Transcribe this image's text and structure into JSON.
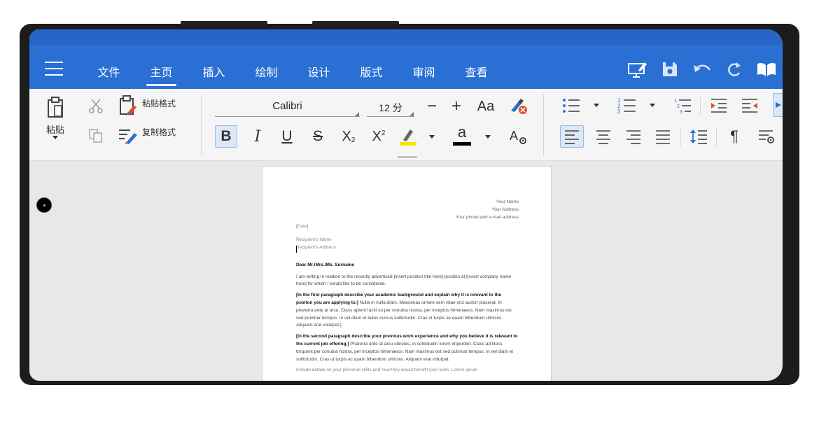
{
  "menu": {
    "icon": "hamburger-menu-icon"
  },
  "tabs": [
    "文件",
    "主页",
    "插入",
    "绘制",
    "设计",
    "版式",
    "审阅",
    "查看"
  ],
  "active_tab": "主页",
  "top_icons": [
    "present-icon",
    "save-icon",
    "undo-icon",
    "redo-icon",
    "read-mode-icon"
  ],
  "ribbon": {
    "paste_label": "粘贴",
    "paste_format_label": "粘贴格式",
    "copy_format_label": "复制格式",
    "font_name": "Calibri",
    "font_size": "12 分",
    "case_label": "Aa",
    "bold": "B",
    "italic": "I",
    "underline": "U",
    "strikethrough": "S",
    "subscript": "X",
    "subscript_sub": "2",
    "superscript": "X",
    "superscript_sup": "2",
    "highlight_letter": "✎",
    "font_color_letter": "a",
    "highlight_color": "#f7e600",
    "font_color": "#000000",
    "accent_color": "#2a6fd4"
  },
  "document": {
    "sender": [
      "Your Name",
      "Your Address",
      "Your phone and e-mail address"
    ],
    "date": "[Date]",
    "recipient": [
      "Recipient's Name",
      "Recipient's Address"
    ],
    "salutation": "Dear Mr./Mrs./Ms. Surname",
    "intro": "I am writing in relation to the recently advertised [insert position title here] position at [insert company name here] for which I would like to be considered.",
    "p1_bold": "[In the first paragraph describe your academic background and explain why it is relevant to the positon you are applying to.]",
    "p1_text": " Nulla in nulla diam. Maecenas ornare sem vitae orci auctor placerat. In pharetra ante at arcu. Class aptent taciti so per conubia nostra, per inceptos himenaeos. Nam maximus est sed pulvinar tempus. In vel diam et tellus cursus sollicitudin. Cras ut turpis ac quam bibendum ultricies. Aliquam erat volutpat.]",
    "p2_bold": "[In the second paragraph describe your previous work experience and why you believe it is relevant to the current job offering.]",
    "p2_text": " Pharetra ante at arcu ultricies, in sollicitudin lorem imperdiet. Class ad litora torquent per conubia nostra, per inceptos himenaeos. Nam maximus est sed pulvinar tempus. In vel diam et sollicitudin. Cras ut turpis ac quam bibendum ultricies. Aliquam erat volutpat.",
    "p3_partial": "Include details on your personal skills and how they would benefit your work. Lorem ipsum"
  }
}
